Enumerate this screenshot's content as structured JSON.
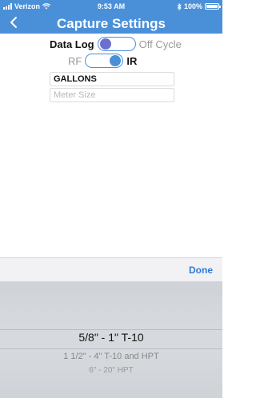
{
  "status_bar": {
    "carrier": "Verizon",
    "time": "9:53 AM",
    "battery": "100%"
  },
  "nav": {
    "title": "Capture Settings"
  },
  "settings": {
    "data_log_label": "Data Log",
    "off_cycle_label": "Off Cycle",
    "data_log_toggle": "off",
    "rf_label": "RF",
    "ir_label": "IR",
    "rf_ir_toggle": "on",
    "units_value": "GALLONS",
    "meter_size_placeholder": "Meter Size"
  },
  "picker": {
    "done_label": "Done",
    "options": [
      "5/8\" - 1\" T-10",
      "1 1/2\" - 4\" T-10 and HPT",
      "6\" - 20\" HPT"
    ],
    "selected_index": 0
  },
  "colors": {
    "accent": "#4a90d9",
    "toggle_knob_off": "#6c6fcf",
    "done": "#2e7ad6"
  }
}
